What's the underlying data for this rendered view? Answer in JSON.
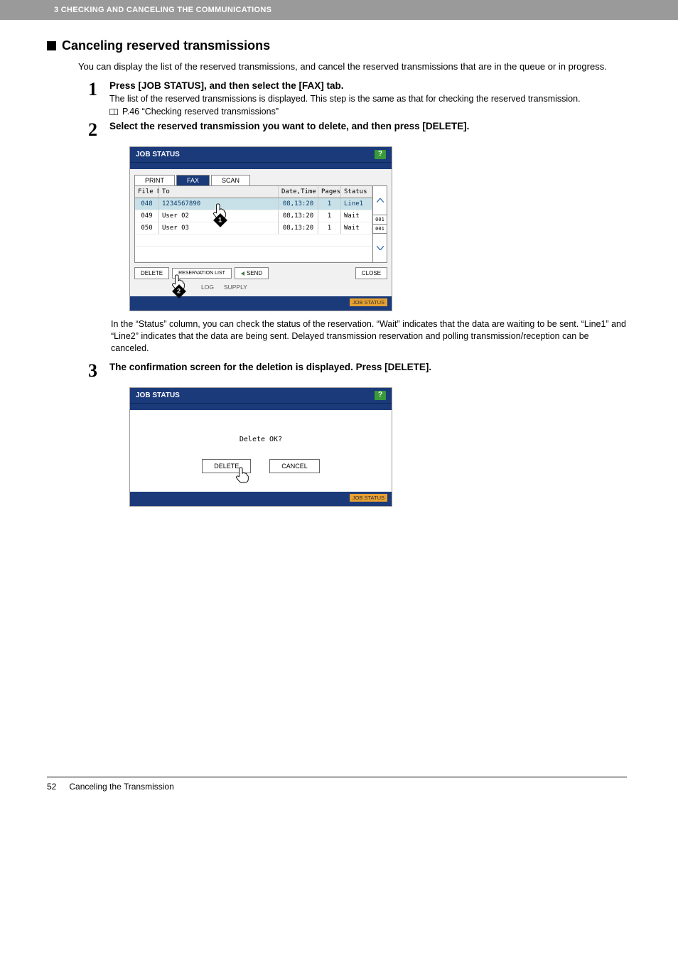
{
  "header": {
    "breadcrumb": "3 CHECKING AND CANCELING THE COMMUNICATIONS"
  },
  "section": {
    "title": "Canceling reserved transmissions",
    "intro": "You can display the list of the reserved transmissions, and cancel the reserved transmissions that are in the queue or in progress."
  },
  "steps": [
    {
      "num": "1",
      "title": "Press [JOB STATUS], and then select the [FAX] tab.",
      "text": "The list of the reserved transmissions is displayed. This step is the same as that for checking the reserved transmission.",
      "xref": "P.46 “Checking reserved transmissions”"
    },
    {
      "num": "2",
      "title": "Select the reserved transmission you want to delete, and then press [DELETE].",
      "after": "In the “Status” column, you can check the status of the reservation. “Wait” indicates that the data are waiting to be sent. “Line1” and “Line2” indicates that the data are being sent. Delayed transmission reservation and polling transmission/reception can be canceled."
    },
    {
      "num": "3",
      "title": "The confirmation screen for the deletion is displayed. Press [DELETE]."
    }
  ],
  "panel1": {
    "title": "JOB STATUS",
    "tabs": [
      "PRINT",
      "FAX",
      "SCAN"
    ],
    "headers": {
      "file": "File No.",
      "to": "To",
      "date": "Date,Time",
      "pages": "Pages",
      "status": "Status"
    },
    "rows": [
      {
        "file": "048",
        "to": "1234567890",
        "date": "08,13:20",
        "pages": "1",
        "status": "Line1",
        "selected": true
      },
      {
        "file": "049",
        "to": "User 02",
        "date": "08,13:20",
        "pages": "1",
        "status": "Wait",
        "selected": false
      },
      {
        "file": "050",
        "to": "User 03",
        "date": "08,13:20",
        "pages": "1",
        "status": "Wait",
        "selected": false
      }
    ],
    "scroll": {
      "page": "001",
      "total": "001"
    },
    "buttons": {
      "delete": "DELETE",
      "reservation": "RESERVATION LIST",
      "send": "SEND",
      "close": "CLOSE"
    },
    "sub_tabs": {
      "log": "LOG",
      "supply": "SUPPLY"
    },
    "footer_badge": "JOB STATUS"
  },
  "panel2": {
    "title": "JOB STATUS",
    "message": "Delete OK?",
    "buttons": {
      "delete": "DELETE",
      "cancel": "CANCEL"
    },
    "footer_badge": "JOB STATUS"
  },
  "footer": {
    "page": "52",
    "title": "Canceling the Transmission"
  }
}
